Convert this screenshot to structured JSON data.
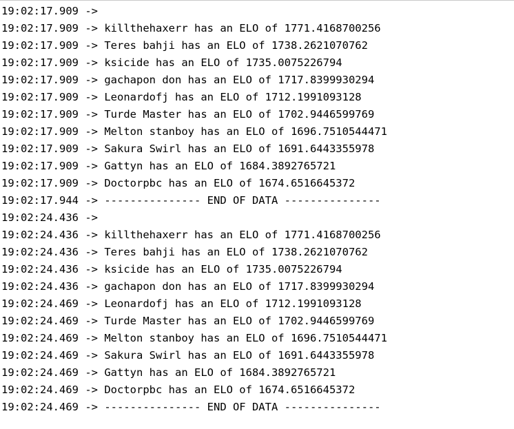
{
  "serial_monitor": {
    "lines": [
      {
        "time": "19:02:17.909",
        "arrow": "->",
        "message": ""
      },
      {
        "time": "19:02:17.909",
        "arrow": "->",
        "message": "killthehaxerr has an ELO of 1771.4168700256"
      },
      {
        "time": "19:02:17.909",
        "arrow": "->",
        "message": "Teres bahji has an ELO of 1738.2621070762"
      },
      {
        "time": "19:02:17.909",
        "arrow": "->",
        "message": "ksicide has an ELO of 1735.0075226794"
      },
      {
        "time": "19:02:17.909",
        "arrow": "->",
        "message": "gachapon don has an ELO of 1717.8399930294"
      },
      {
        "time": "19:02:17.909",
        "arrow": "->",
        "message": "Leonardofj has an ELO of 1712.1991093128"
      },
      {
        "time": "19:02:17.909",
        "arrow": "->",
        "message": "Turde Master has an ELO of 1702.9446599769"
      },
      {
        "time": "19:02:17.909",
        "arrow": "->",
        "message": "Melton stanboy has an ELO of 1696.7510544471"
      },
      {
        "time": "19:02:17.909",
        "arrow": "->",
        "message": "Sakura Swirl has an ELO of 1691.6443355978"
      },
      {
        "time": "19:02:17.909",
        "arrow": "->",
        "message": "Gattyn has an ELO of 1684.3892765721"
      },
      {
        "time": "19:02:17.909",
        "arrow": "->",
        "message": "Doctorpbc has an ELO of 1674.6516645372"
      },
      {
        "time": "19:02:17.944",
        "arrow": "->",
        "message": "--------------- END OF DATA ---------------"
      },
      {
        "time": "19:02:24.436",
        "arrow": "->",
        "message": ""
      },
      {
        "time": "19:02:24.436",
        "arrow": "->",
        "message": "killthehaxerr has an ELO of 1771.4168700256"
      },
      {
        "time": "19:02:24.436",
        "arrow": "->",
        "message": "Teres bahji has an ELO of 1738.2621070762"
      },
      {
        "time": "19:02:24.436",
        "arrow": "->",
        "message": "ksicide has an ELO of 1735.0075226794"
      },
      {
        "time": "19:02:24.436",
        "arrow": "->",
        "message": "gachapon don has an ELO of 1717.8399930294"
      },
      {
        "time": "19:02:24.469",
        "arrow": "->",
        "message": "Leonardofj has an ELO of 1712.1991093128"
      },
      {
        "time": "19:02:24.469",
        "arrow": "->",
        "message": "Turde Master has an ELO of 1702.9446599769"
      },
      {
        "time": "19:02:24.469",
        "arrow": "->",
        "message": "Melton stanboy has an ELO of 1696.7510544471"
      },
      {
        "time": "19:02:24.469",
        "arrow": "->",
        "message": "Sakura Swirl has an ELO of 1691.6443355978"
      },
      {
        "time": "19:02:24.469",
        "arrow": "->",
        "message": "Gattyn has an ELO of 1684.3892765721"
      },
      {
        "time": "19:02:24.469",
        "arrow": "->",
        "message": "Doctorpbc has an ELO of 1674.6516645372"
      },
      {
        "time": "19:02:24.469",
        "arrow": "->",
        "message": "--------------- END OF DATA ---------------"
      }
    ]
  }
}
